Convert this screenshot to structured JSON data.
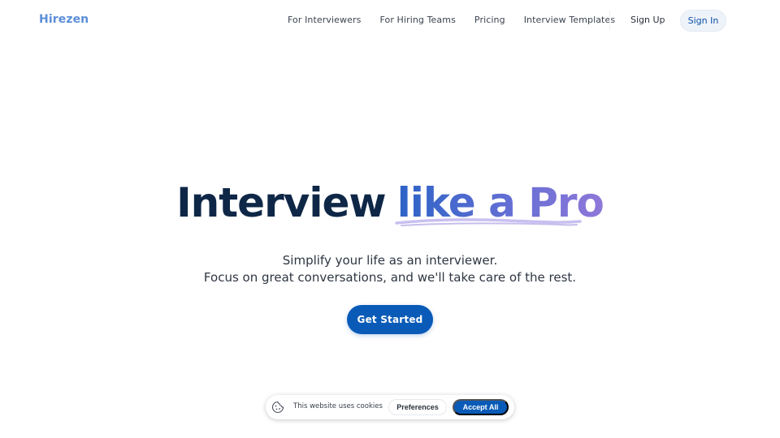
{
  "nav": {
    "logo": "Hirezen",
    "links": [
      {
        "label": "For Interviewers"
      },
      {
        "label": "For Hiring Teams"
      },
      {
        "label": "Pricing"
      },
      {
        "label": "Interview Templates"
      }
    ],
    "sign_up": "Sign Up",
    "sign_in": "Sign In"
  },
  "hero": {
    "title_main": "Interview",
    "title_accent": "like a Pro",
    "subtitle_line1": "Simplify your life as an interviewer.",
    "subtitle_line2": "Focus on great conversations, and we'll take care of the rest.",
    "cta": "Get Started"
  },
  "cookie": {
    "message": "This website uses cookies",
    "preferences": "Preferences",
    "accept_all": "Accept All"
  },
  "colors": {
    "brand_blue": "#0a5bb8",
    "logo_blue": "#5b8ed8",
    "title_navy": "#0f2747",
    "accent_gradient_start": "#2c63c6",
    "accent_gradient_end": "#8f78d9",
    "swash_lavender": "#b9aee8"
  },
  "icons": {
    "cookie": "cookie-icon"
  }
}
